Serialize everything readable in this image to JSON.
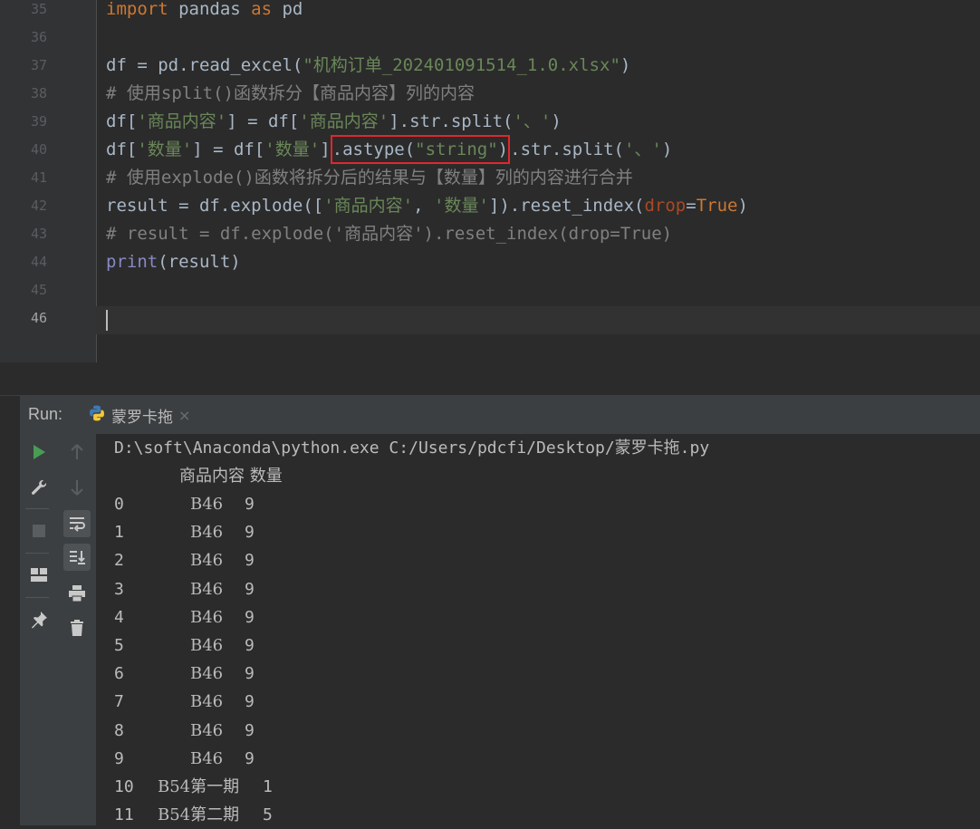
{
  "editor": {
    "line_numbers": [
      "35",
      "36",
      "37",
      "38",
      "39",
      "40",
      "41",
      "42",
      "43",
      "44",
      "45",
      "46"
    ],
    "lines": {
      "l35": {
        "import_kw": "import",
        "module": " pandas ",
        "as_kw": "as",
        "alias": " pd"
      },
      "l37": {
        "pre": "df = pd.read_excel(",
        "str": "\"机构订单_202401091514_1.0.xlsx\"",
        "post": ")"
      },
      "l38": {
        "comment": "# 使用split()函数拆分【商品内容】列的内容"
      },
      "l39": {
        "a": "df[",
        "s1": "'商品内容'",
        "b": "] = df[",
        "s2": "'商品内容'",
        "c": "].str.split(",
        "s3": "'、'",
        "d": ")"
      },
      "l40": {
        "a": "df[",
        "s1": "'数量'",
        "b": "] = df[",
        "s2": "'数量'",
        "c": "]",
        "box_pre": ".astype(",
        "box_str": "\"string\"",
        "box_post": ")",
        "d": ".str.split(",
        "s3": "'、'",
        "e": ")"
      },
      "l41": {
        "comment": "# 使用explode()函数将拆分后的结果与【数量】列的内容进行合并"
      },
      "l42": {
        "a": "result = df.explode([",
        "s1": "'商品内容'",
        "b": ", ",
        "s2": "'数量'",
        "c": "]).reset_index(",
        "kwarg": "drop",
        "eq": "=",
        "val": "True",
        "d": ")"
      },
      "l43": {
        "comment": "# result = df.explode('商品内容').reset_index(drop=True)"
      },
      "l44": {
        "fn": "print",
        "rest": "(result)"
      }
    }
  },
  "run_panel": {
    "label": "Run:",
    "tab_label": "蒙罗卡拖",
    "tab_close": "×",
    "toolbar_icons": [
      "run-icon",
      "up-arrow-icon",
      "wrench-icon",
      "down-arrow-icon",
      "stop-icon",
      "soft-wrap-icon",
      "layout-icon",
      "scroll-to-end-icon",
      "print-icon",
      "pin-icon",
      "trash-icon"
    ]
  },
  "console": {
    "command": "D:\\soft\\Anaconda\\python.exe C:/Users/pdcfi/Desktop/蒙罗卡拖.py",
    "header": {
      "col1": "商品内容",
      "col2": "数量"
    },
    "rows": [
      {
        "idx": "0",
        "product": "B46",
        "qty": "9"
      },
      {
        "idx": "1",
        "product": "B46",
        "qty": "9"
      },
      {
        "idx": "2",
        "product": "B46",
        "qty": "9"
      },
      {
        "idx": "3",
        "product": "B46",
        "qty": "9"
      },
      {
        "idx": "4",
        "product": "B46",
        "qty": "9"
      },
      {
        "idx": "5",
        "product": "B46",
        "qty": "9"
      },
      {
        "idx": "6",
        "product": "B46",
        "qty": "9"
      },
      {
        "idx": "7",
        "product": "B46",
        "qty": "9"
      },
      {
        "idx": "8",
        "product": "B46",
        "qty": "9"
      },
      {
        "idx": "9",
        "product": "B46",
        "qty": "9"
      },
      {
        "idx": "10",
        "product": "B54第一期",
        "qty": "1"
      },
      {
        "idx": "11",
        "product": "B54第二期",
        "qty": "5"
      }
    ]
  },
  "colors": {
    "keyword": "#cc7832",
    "string": "#6a8759",
    "comment": "#808080",
    "builtin": "#8888c6",
    "highlight_box": "#e0272c",
    "run_green": "#499c54"
  }
}
